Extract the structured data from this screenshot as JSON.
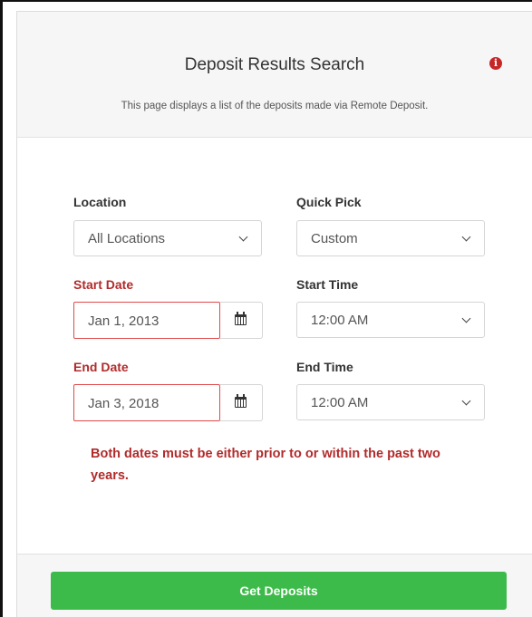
{
  "header": {
    "title": "Deposit Results Search",
    "subtitle": "This page displays a list of the deposits made via Remote Deposit.",
    "info_icon_glyph": "i",
    "info_icon_color": "#c62828"
  },
  "form": {
    "location": {
      "label": "Location",
      "value": "All Locations"
    },
    "quick_pick": {
      "label": "Quick Pick",
      "value": "Custom"
    },
    "start_date": {
      "label": "Start Date",
      "value": "Jan 1, 2013"
    },
    "start_time": {
      "label": "Start Time",
      "value": "12:00 AM"
    },
    "end_date": {
      "label": "End Date",
      "value": "Jan 3, 2018"
    },
    "end_time": {
      "label": "End Time",
      "value": "12:00 AM"
    },
    "error_message": "Both dates must be either prior to or within the past two years."
  },
  "footer": {
    "submit_label": "Get Deposits",
    "submit_color": "#3dbb4a"
  },
  "colors": {
    "error": "#b22b2b",
    "error_border": "#e04a4a"
  }
}
